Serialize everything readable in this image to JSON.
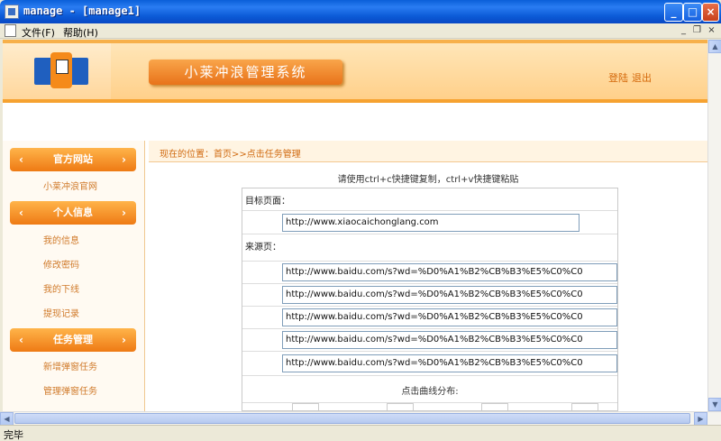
{
  "window": {
    "title": "manage - [manage1]",
    "buttons": {
      "minimize": "_",
      "maximize": "□",
      "close": "×"
    }
  },
  "menubar": {
    "items": [
      "文件(F)",
      "帮助(H)"
    ]
  },
  "header": {
    "system_title": "小莱冲浪管理系统",
    "login_link": "登陆",
    "logout_link": "退出"
  },
  "sidebar": {
    "sections": [
      {
        "title": "官方网站",
        "links": [
          "小莱冲浪官网"
        ]
      },
      {
        "title": "个人信息",
        "links": [
          "我的信息",
          "修改密码",
          "我的下线",
          "提现记录"
        ]
      },
      {
        "title": "任务管理",
        "links": [
          "新增弹窗任务",
          "管理弹窗任务"
        ]
      }
    ]
  },
  "main": {
    "breadcrumb": "现在的位置：首页>>点击任务管理",
    "hint": "请使用ctrl+c快捷键复制，ctrl+v快捷键粘贴",
    "target_label": "目标页面：",
    "target_url": "http://www.xiaocaichonglang.com",
    "source_label": "来源页：",
    "source_urls": [
      "http://www.baidu.com/s?wd=%D0%A1%B2%CB%B3%E5%C0%C0",
      "http://www.baidu.com/s?wd=%D0%A1%B2%CB%B3%E5%C0%C0",
      "http://www.baidu.com/s?wd=%D0%A1%B2%CB%B3%E5%C0%C0",
      "http://www.baidu.com/s?wd=%D0%A1%B2%CB%B3%E5%C0%C0",
      "http://www.baidu.com/s?wd=%D0%A1%B2%CB%B3%E5%C0%C0"
    ],
    "curve_label": "点击曲线分布:"
  },
  "status": {
    "text": "完毕"
  }
}
